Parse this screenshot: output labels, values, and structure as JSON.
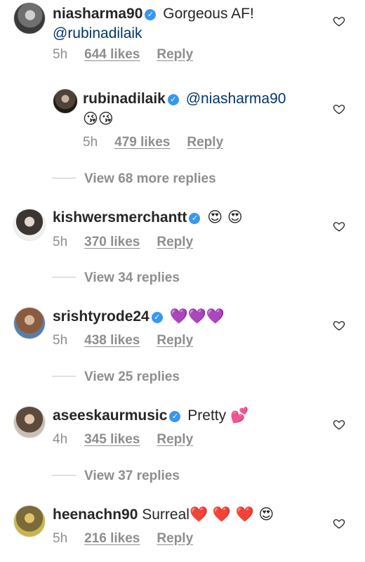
{
  "comments": [
    {
      "username": "niasharma90",
      "verified": true,
      "text": "Gorgeous AF!",
      "mention": "@rubinadilaik",
      "time": "5h",
      "likes": "644 likes",
      "reply": "Reply"
    },
    {
      "username": "rubinadilaik",
      "verified": true,
      "mention": "@niasharma90",
      "emojis": "😘😘",
      "time": "5h",
      "likes": "479 likes",
      "reply": "Reply"
    },
    {
      "view_more": "View 68 more replies"
    },
    {
      "username": "kishwersmerchantt",
      "verified": true,
      "emojis": "😍 😍",
      "time": "5h",
      "likes": "370 likes",
      "reply": "Reply",
      "view_more": "View 34 replies"
    },
    {
      "username": "srishtyrode24",
      "verified": true,
      "emojis": "💜💜💜",
      "time": "5h",
      "likes": "438 likes",
      "reply": "Reply",
      "view_more": "View 25 replies"
    },
    {
      "username": "aseeskaurmusic",
      "verified": true,
      "text": "Pretty",
      "emojis": "💕",
      "time": "4h",
      "likes": "345 likes",
      "reply": "Reply",
      "view_more": "View 37 replies"
    },
    {
      "username": "heenachn90",
      "verified": false,
      "text": "Surreal",
      "emojis": "❤️ ❤️ ❤️ 😍",
      "time": "5h",
      "likes": "216 likes",
      "reply": "Reply"
    }
  ],
  "icons": {
    "verified": "verified-badge-icon",
    "like": "heart-outline-icon"
  },
  "colors": {
    "verified": "#3897f0",
    "mention": "#00376b",
    "meta": "#8e8e8e"
  }
}
